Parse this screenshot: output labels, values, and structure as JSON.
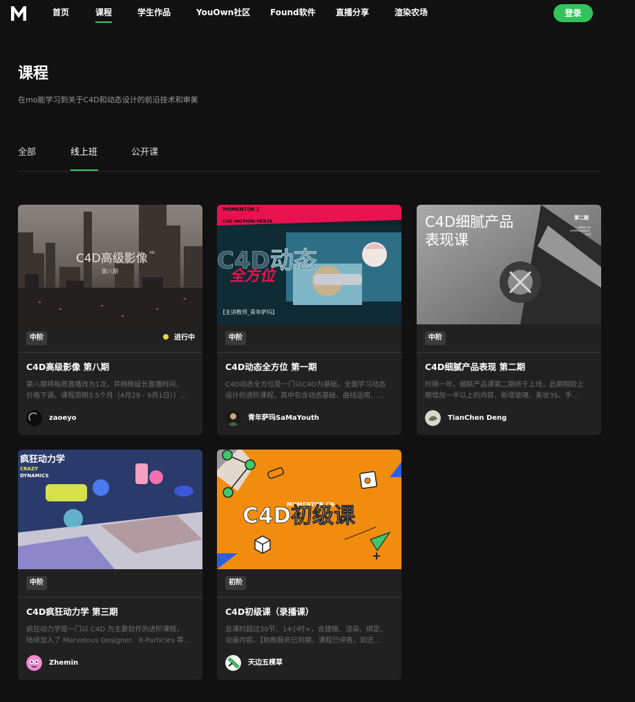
{
  "nav": {
    "logo": "M",
    "items": [
      {
        "label": "首页"
      },
      {
        "label": "课程",
        "active": true
      },
      {
        "label": "学生作品"
      },
      {
        "label": "YouOwn社区"
      },
      {
        "label": "Found软件"
      },
      {
        "label": "直播分享"
      },
      {
        "label": "渲染农场"
      }
    ],
    "login_label": "登录"
  },
  "header": {
    "title": "课程",
    "subtitle": "在mo能学习到关于C4D和动态设计的前沿技术和审美"
  },
  "tabs": [
    {
      "label": "全部"
    },
    {
      "label": "线上班",
      "active": true
    },
    {
      "label": "公开课"
    }
  ],
  "colors": {
    "accent": "#33c35d",
    "background": "#111111",
    "card": "#212121",
    "status_dot": "#f4d03f"
  },
  "courses": [
    {
      "level": "中阶",
      "status": "进行中",
      "title": "C4D高级影像 第八期",
      "desc": [
        "第八期将每周直播改为1次，并稍微延长直播时间，",
        "价格下调。课程周期3.5个月（4月29 - 9月1日））..."
      ],
      "author": "zaoeyo",
      "thumb_text": {
        "main": "C4D高级影像",
        "sup": "VIII",
        "sub": "第八期"
      }
    },
    {
      "level": "中阶",
      "title": "C4D动态全方位 第一期",
      "desc": [
        "C4D动态全方位是一门以C4D为基础，全面学习动态",
        "设计的进阶课程。其中包含动态基础、曲线运用、..."
      ],
      "author": "青年萨玛SaMaYouth",
      "thumb_text": {
        "top1": "MOMENTOR ]",
        "top2": "C4D MOTION-VERSE",
        "main": "C4D动态",
        "script": "全方位",
        "teacher": "【主讲教师_青年萨玛】"
      }
    },
    {
      "level": "中阶",
      "title": "C4D细腻产品表现 第二期",
      "desc": [
        "时隔一年，细腻产品课第二期终于上线，此期相较上",
        "期增加一半以上的内容，新增玻璃、美妆3S、手..."
      ],
      "author": "TianChen Deng",
      "thumb_text": {
        "line1": "C4D细腻产品",
        "line2": "表现课",
        "issue": "第二期",
        "small1": "CINEMA 4D",
        "small2": "HYPERPRODUCT",
        "small3": "2022"
      }
    },
    {
      "level": "中阶",
      "title": "C4D疯狂动力学 第三期",
      "desc": [
        "疯狂动力学是一门以 C4D 为主要软件的进阶课程，",
        "陆续加入了 Marvelous Designer、X-Particles 等..."
      ],
      "author": "Zhemin",
      "thumb_text": {
        "cn": "疯狂动力学",
        "en1": "CRAZY",
        "en2": "DYNAMICS"
      }
    },
    {
      "level": "初阶",
      "title": "C4D初级课（录播课）",
      "desc": [
        "总课时超过30节、14小时+，含建模、渲染、绑定、",
        "动画内容。【助教服务已到期，课程已停售，如还..."
      ],
      "author": "天边五棵草",
      "thumb_text": {
        "site": "MOMENTOR.CN",
        "main": "C4D初级课"
      }
    }
  ]
}
